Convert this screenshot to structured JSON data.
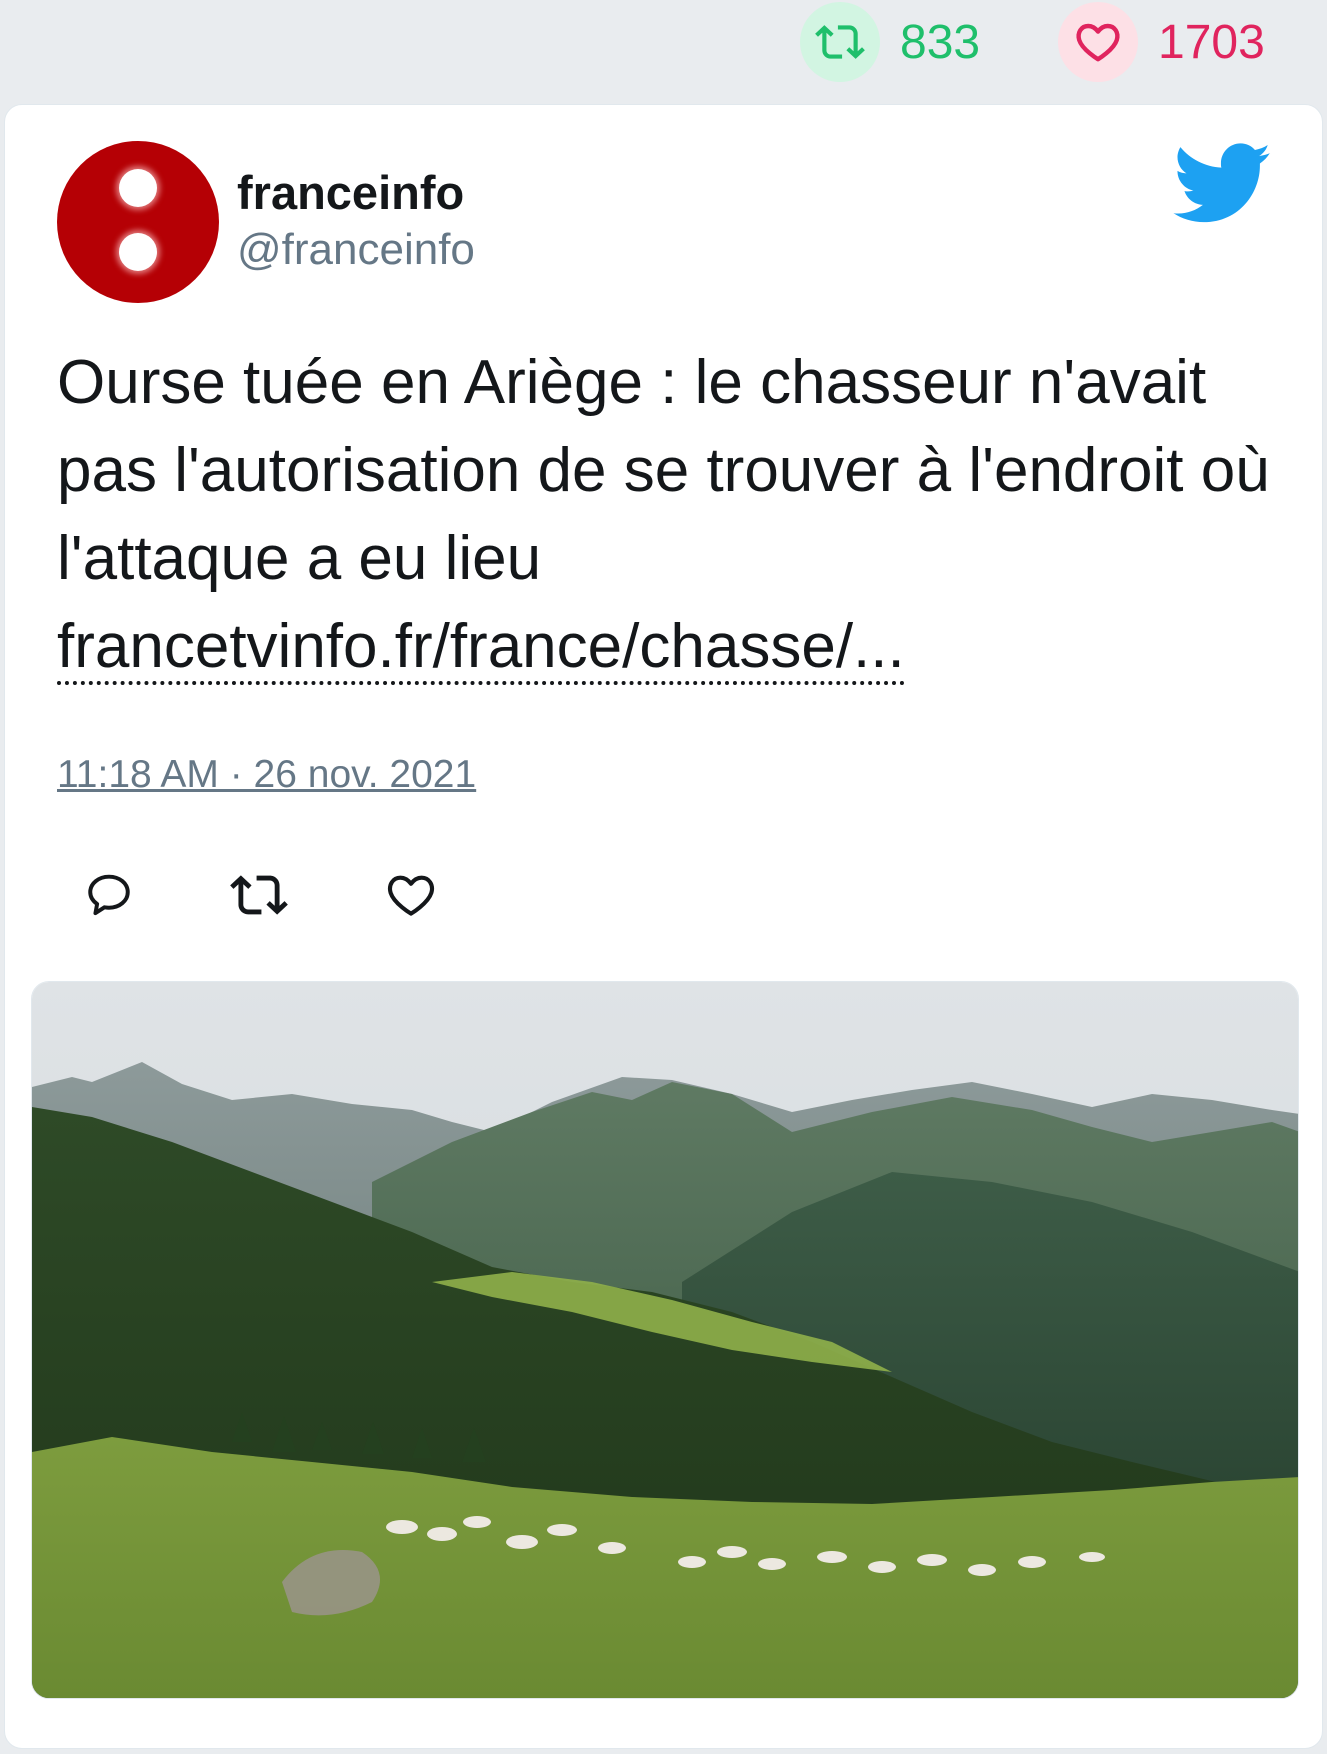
{
  "stats": {
    "retweets": "833",
    "likes": "1703",
    "retweet_color": "#1fbf6b",
    "like_color": "#e0245e"
  },
  "author": {
    "name": "franceinfo",
    "handle": "@franceinfo",
    "avatar_color": "#b50005"
  },
  "tweet": {
    "text": "Ourse tuée en Ariège : le chasseur n'avait pas l'autorisation de se trouver à l'endroit où l'attaque a eu lieu",
    "link": "francetvinfo.fr/france/chasse/...",
    "timestamp": "11:18 AM · 26 nov. 2021"
  },
  "icons": {
    "retweet": "retweet-icon",
    "like": "heart-icon",
    "reply": "reply-icon",
    "brand": "twitter-bird-icon"
  },
  "media": {
    "type": "photo",
    "subject": "mountain-pasture"
  }
}
